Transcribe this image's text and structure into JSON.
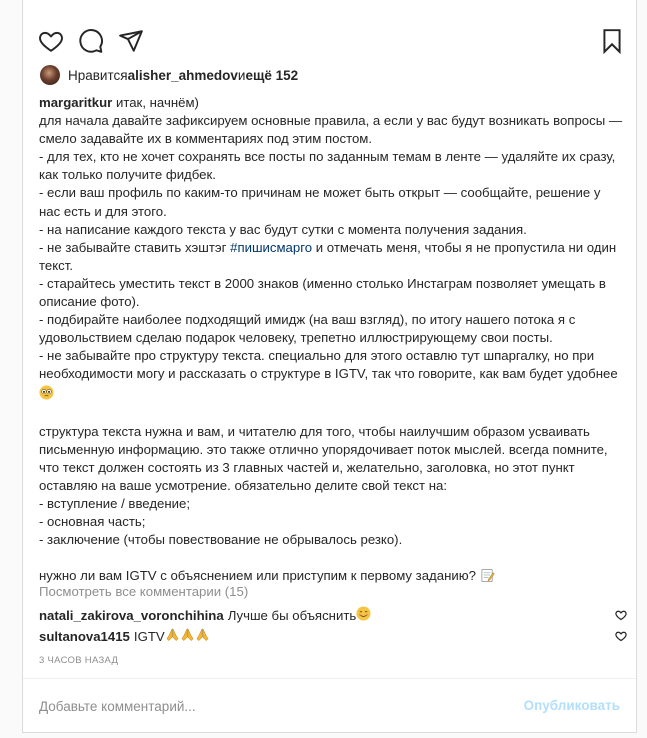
{
  "actions": {
    "like_icon": "heart-icon",
    "comment_icon": "comment-icon",
    "share_icon": "paper-plane-icon",
    "save_icon": "bookmark-icon"
  },
  "likes": {
    "prefix": "Нравится ",
    "user": "alisher_ahmedov",
    "middle": " и ",
    "more": "ещё 152"
  },
  "caption": {
    "username": "margaritkur",
    "p1": " итак, начнём)\nдля начала давайте зафиксируем основные правила, а если у вас будут возникать вопросы — смело задавайте их в комментариях под этим постом.\n- для тех, кто не хочет сохранять все посты по заданным темам в ленте — удаляйте их сразу, как только получите фидбек.\n- если ваш профиль по каким-то причинам не может быть открыт — сообщайте, решение у нас есть и для этого.\n- на написание каждого текста у вас будут сутки с момента получения задания.\n- не забывайте ставить хэштэг ",
    "hashtag": "#пишисмарго",
    "p2": " и отмечать меня, чтобы я не пропустила ни один текст.\n- старайтесь уместить текст в 2000 знаков (именно столько Инстаграм позволяет умещать в описание фото).\n- подбирайте наиболее подходящий имидж (на ваш взгляд), по итогу нашего потока я с удовольствием сделаю подарок человеку, трепетно иллюстрирующему свои посты.\n- не забывайте про структуру текста. специально для этого оставлю тут шпаргалку, но при необходимости могу и рассказать о структуре в IGTV, так что говорите, как вам будет удобнее ",
    "p3": "\n\nструктура текста нужна и вам, и читателю для того, чтобы наилучшим образом усваивать письменную информацию. это также отлично упорядочивает поток мыслей. всегда помните, что текст должен состоять из 3 главных частей и, желательно, заголовка, но этот пункт оставляю на ваше усмотрение. обязательно делите свой текст на:\n- вступление / введение;\n- основная часть;\n- заключение (чтобы повествование не обрывалось резко).\n\nнужно ли вам IGTV с объяснением или приступим к первому заданию? "
  },
  "view_all": "Посмотреть все комментарии (15)",
  "comments": [
    {
      "user": "natali_zakirova_voronchihina",
      "text": "Лучше бы объяснить "
    },
    {
      "user": "sultanova1415",
      "text": "IGTV "
    }
  ],
  "timestamp": "3 ЧАСОВ НАЗАД",
  "comment_box": {
    "placeholder": "Добавьте комментарий...",
    "publish": "Опубликовать"
  },
  "colors": {
    "text": "#262626",
    "muted": "#8e8e8e",
    "link": "#00376b",
    "publish_disabled": "#b2dffc"
  }
}
